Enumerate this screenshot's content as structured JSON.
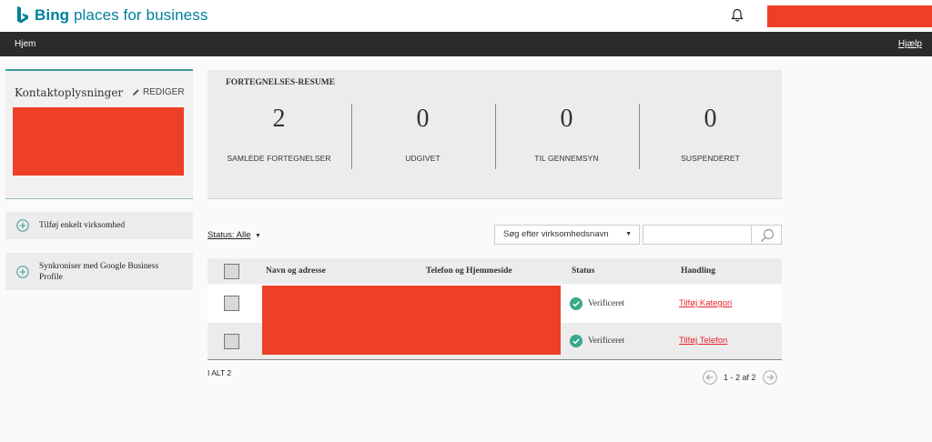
{
  "header": {
    "brand_bold": "Bing",
    "brand_rest": " places for business",
    "notifications_icon": "bell-icon"
  },
  "nav": {
    "home": "Hjem",
    "help": "Hjælp"
  },
  "sidebar": {
    "contact_title": "Kontaktoplysninger",
    "edit_label": "REDIGER",
    "add_business_label": "Tilføj enkelt virksomhed",
    "sync_label": "Synkroniser med Google Business Profile"
  },
  "summary": {
    "title": "FORTEGNELSES-RESUME",
    "stats": [
      {
        "value": "2",
        "label": "SAMLEDE FORTEGNELSER"
      },
      {
        "value": "0",
        "label": "UDGIVET"
      },
      {
        "value": "0",
        "label": "TIL GENNEMSYN"
      },
      {
        "value": "0",
        "label": "SUSPENDERET"
      }
    ]
  },
  "filters": {
    "status_label": "Status: Alle",
    "search_by": "Søg efter virksomhedsnavn",
    "search_value": ""
  },
  "table": {
    "headers": [
      "Navn og adresse",
      "Telefon og Hjemmeside",
      "Status",
      "Handling"
    ],
    "rows": [
      {
        "status": "Verificeret",
        "action": "Tilføj Kategori"
      },
      {
        "status": "Verificeret",
        "action": "Tilføj Telefon"
      }
    ]
  },
  "footer": {
    "total": "I ALT 2",
    "page_range": "1 - 2 af 2"
  },
  "colors": {
    "brand": "#00809d",
    "accent_teal": "#3d9a9b",
    "redaction": "#ee4026",
    "link_red": "#e8262b",
    "verified_green": "#3aa78a",
    "navbar": "#2b2b2b"
  }
}
